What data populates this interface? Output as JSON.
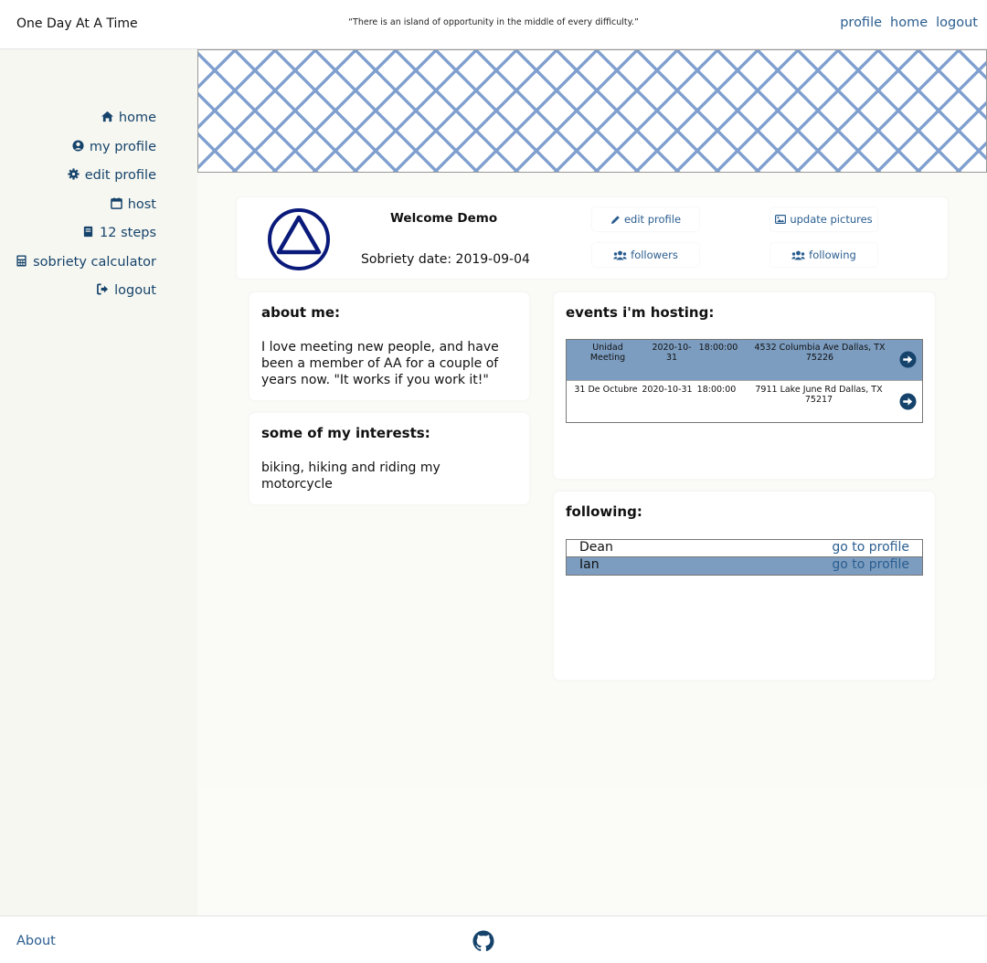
{
  "header": {
    "brand": "One Day At A Time",
    "quote": "“There is an island of opportunity in the middle of every difficulty.”",
    "nav": [
      "profile",
      "home",
      "logout"
    ]
  },
  "sidebar": {
    "items": [
      {
        "label": "home",
        "icon": "home-icon"
      },
      {
        "label": "my profile",
        "icon": "user-circle-icon"
      },
      {
        "label": "edit profile",
        "icon": "gear-icon"
      },
      {
        "label": "host",
        "icon": "calendar-icon"
      },
      {
        "label": "12 steps",
        "icon": "book-icon"
      },
      {
        "label": "sobriety calculator",
        "icon": "calculator-icon"
      },
      {
        "label": "logout",
        "icon": "sign-out-icon"
      }
    ]
  },
  "profile": {
    "welcome": "Welcome Demo",
    "sobriety": "Sobriety date: 2019-09-04",
    "buttons": {
      "edit_profile": "edit profile",
      "update_pictures": "update pictures",
      "followers": "followers",
      "following": "following"
    }
  },
  "about": {
    "title": "about me:",
    "text": "I love meeting new people, and have been a member of AA for a couple of years now. \"It works if you work it!\""
  },
  "interests": {
    "title": "some of my interests:",
    "text": "biking, hiking and riding my motorcycle"
  },
  "events": {
    "title": "events i'm hosting:",
    "rows": [
      {
        "name": "Unidad Meeting",
        "date": "2020-10-31",
        "time": "18:00:00",
        "address": "4532 Columbia Ave Dallas, TX 75226"
      },
      {
        "name": "31 De Octubre",
        "date": "2020-10-31",
        "time": "18:00:00",
        "address": "7911 Lake June Rd Dallas, TX 75217"
      }
    ]
  },
  "following": {
    "title": "following:",
    "link_label": "go to profile",
    "rows": [
      {
        "name": "Dean"
      },
      {
        "name": "Ian"
      }
    ]
  },
  "footer": {
    "about": "About",
    "icon": "github-icon"
  },
  "colors": {
    "link": "#2a5d8f",
    "sidebar_text": "#15436b",
    "highlight_row": "#7c9dc0",
    "logo": "#0a1a7a",
    "banner_lattice": "#7f9fcf"
  }
}
